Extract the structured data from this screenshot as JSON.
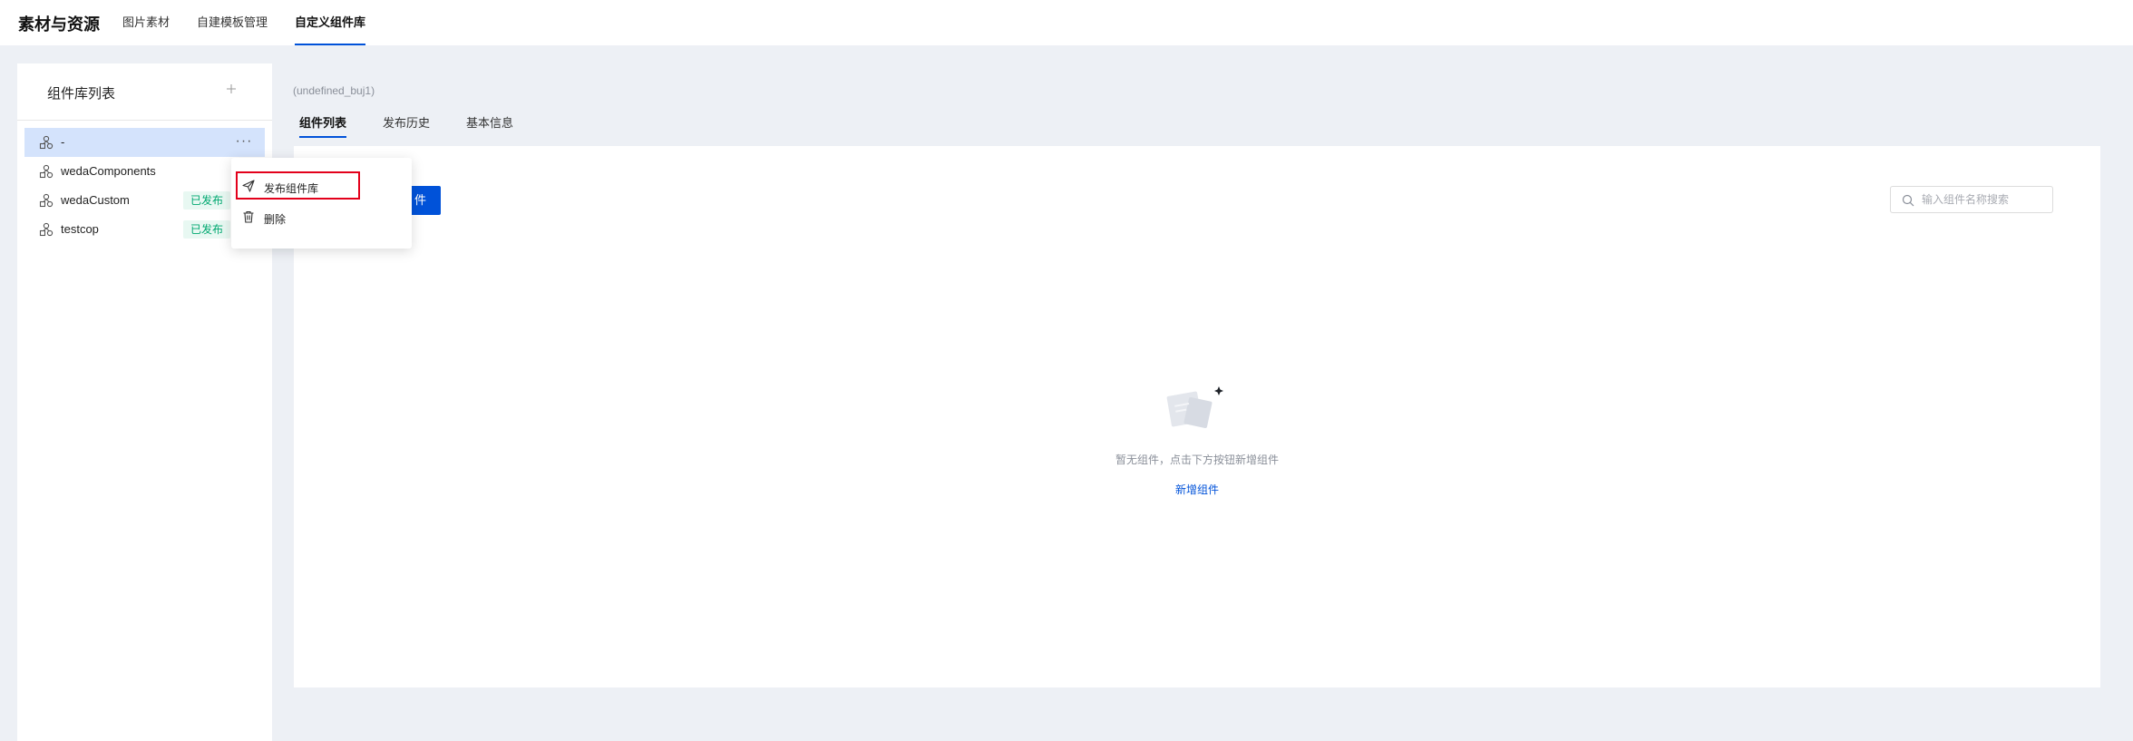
{
  "app": {
    "title": "素材与资源"
  },
  "top_tabs": [
    {
      "label": "图片素材",
      "active": false
    },
    {
      "label": "自建模板管理",
      "active": false
    },
    {
      "label": "自定义组件库",
      "active": true
    }
  ],
  "sidebar": {
    "title": "组件库列表",
    "add_icon": "plus-icon",
    "items": [
      {
        "name": "-",
        "badge": "",
        "selected": true,
        "more": "···"
      },
      {
        "name": "wedaComponents",
        "badge": "",
        "selected": false
      },
      {
        "name": "wedaCustom",
        "badge": "已发布",
        "selected": false
      },
      {
        "name": "testcop",
        "badge": "已发布",
        "selected": false
      }
    ]
  },
  "main": {
    "breadcrumb": "(undefined_buj1)",
    "tabs": [
      {
        "label": "组件列表",
        "active": true
      },
      {
        "label": "发布历史",
        "active": false
      },
      {
        "label": "基本信息",
        "active": false
      }
    ],
    "new_button_visible_text": "件",
    "search": {
      "placeholder": "输入组件名称搜索",
      "value": ""
    },
    "empty": {
      "text": "暂无组件，点击下方按钮新增组件",
      "link": "新增组件"
    }
  },
  "context_menu": {
    "items": [
      {
        "label": "发布组件库",
        "icon": "send-icon",
        "highlighted": true
      },
      {
        "label": "删除",
        "icon": "trash-icon",
        "highlighted": false
      }
    ]
  },
  "colors": {
    "accent": "#0052d9",
    "selected_bg": "#d4e3fc",
    "badge_text": "#00a870",
    "badge_bg": "#e8f8f2",
    "highlight": "#e3001b"
  }
}
